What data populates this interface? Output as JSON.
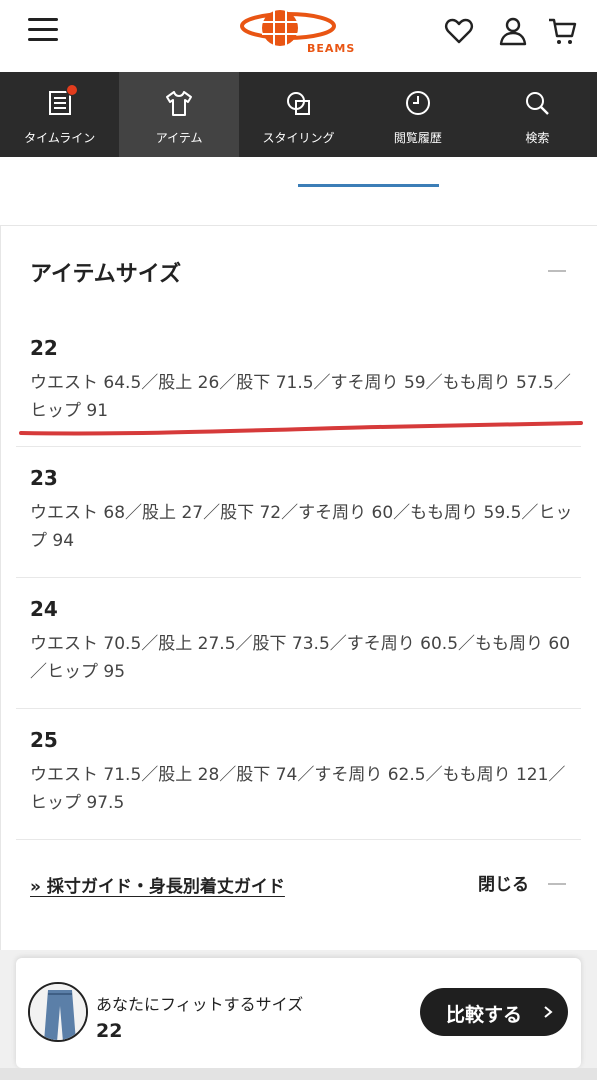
{
  "header": {
    "logo_text": "BEAMS"
  },
  "nav": {
    "items": [
      {
        "label": "タイムライン",
        "icon": "timeline-icon"
      },
      {
        "label": "アイテム",
        "icon": "tshirt-icon"
      },
      {
        "label": "スタイリング",
        "icon": "styling-icon"
      },
      {
        "label": "閲覧履歴",
        "icon": "clock-icon"
      },
      {
        "label": "検索",
        "icon": "search-icon"
      }
    ]
  },
  "section": {
    "title": "アイテムサイズ"
  },
  "sizes": [
    {
      "name": "22",
      "desc": "ウエスト 64.5／股上 26／股下 71.5／すそ周り 59／もも周り 57.5／ヒップ 91"
    },
    {
      "name": "23",
      "desc": "ウエスト 68／股上 27／股下 72／すそ周り 60／もも周り 59.5／ヒップ 94"
    },
    {
      "name": "24",
      "desc": "ウエスト 70.5／股上 27.5／股下 73.5／すそ周り 60.5／もも周り 60／ヒップ 95"
    },
    {
      "name": "25",
      "desc": "ウエスト 71.5／股上 28／股下 74／すそ周り 62.5／もも周り 121／ヒップ 97.5"
    }
  ],
  "footer_links": {
    "guide": "» 採寸ガイド・身長別着丈ガイド",
    "close": "閉じる"
  },
  "fit_bar": {
    "label": "あなたにフィットするサイズ",
    "size": "22",
    "compare": "比較する"
  },
  "colors": {
    "brand": "#e95513",
    "nav_bg": "#2b2b2b",
    "tab_accent": "#3c7eb7",
    "highlight": "#d63a3a"
  }
}
